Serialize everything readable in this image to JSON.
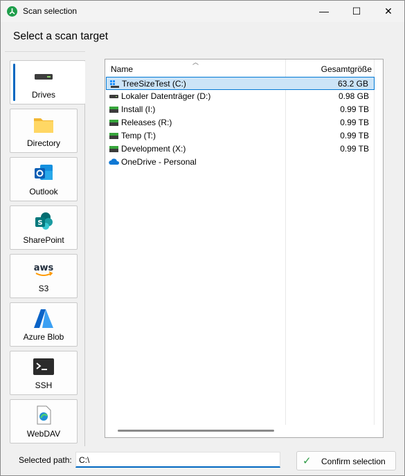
{
  "window": {
    "title": "Scan selection",
    "minimize": "—",
    "maximize": "☐",
    "close": "✕"
  },
  "header": {
    "text": "Select a scan target"
  },
  "sidebar": {
    "items": [
      {
        "label": "Drives",
        "icon": "drive-icon",
        "active": true
      },
      {
        "label": "Directory",
        "icon": "folder-icon"
      },
      {
        "label": "Outlook",
        "icon": "outlook-icon"
      },
      {
        "label": "SharePoint",
        "icon": "sharepoint-icon"
      },
      {
        "label": "S3",
        "icon": "aws-icon",
        "icon_text": "aws"
      },
      {
        "label": "Azure Blob",
        "icon": "azure-icon"
      },
      {
        "label": "SSH",
        "icon": "terminal-icon"
      },
      {
        "label": "WebDAV",
        "icon": "webdav-icon"
      }
    ]
  },
  "list": {
    "columns": {
      "name": "Name",
      "size": "Gesamtgröße"
    },
    "rows": [
      {
        "name": "TreeSizeTest (C:)",
        "size": "63.2 GB",
        "icon": "windows-drive-icon",
        "selected": true
      },
      {
        "name": "Lokaler Datenträger (D:)",
        "size": "0.98 GB",
        "icon": "drive-icon"
      },
      {
        "name": "Install (I:)",
        "size": "0.99 TB",
        "icon": "network-drive-icon"
      },
      {
        "name": "Releases (R:)",
        "size": "0.99 TB",
        "icon": "network-drive-icon"
      },
      {
        "name": "Temp (T:)",
        "size": "0.99 TB",
        "icon": "network-drive-icon"
      },
      {
        "name": "Development (X:)",
        "size": "0.99 TB",
        "icon": "network-drive-icon"
      },
      {
        "name": "OneDrive - Personal",
        "size": "",
        "icon": "onedrive-icon"
      }
    ]
  },
  "footer": {
    "path_label": "Selected path:",
    "path_value": "C:\\",
    "confirm_label": "Confirm selection"
  },
  "colors": {
    "accent": "#0067c0",
    "selection": "#cce4f7",
    "check": "#2e9a45"
  }
}
